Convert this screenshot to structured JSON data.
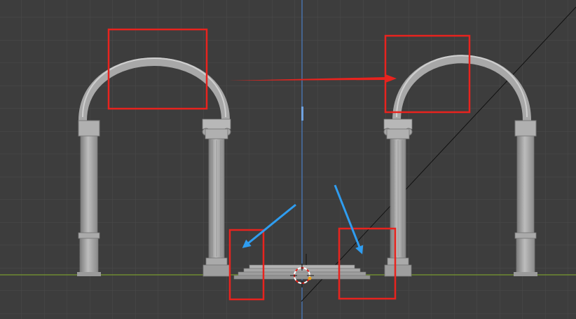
{
  "viewport": {
    "title": "",
    "colors": {
      "background": "#3d3d3d",
      "grid": "#4a4a4a",
      "x_axis": "#7a9a2f",
      "z_axis": "#4b7fc4",
      "model": "#9a9a9a",
      "model_light": "#b3b3b3",
      "model_dark": "#6e6e6e",
      "highlight_box": "#e8231e",
      "red_arrow": "#e8231e",
      "blue_arrow": "#2f9df0",
      "diagonal_line": "#111111"
    },
    "objects": [
      {
        "name": "left-arch",
        "kind": "arch"
      },
      {
        "name": "right-arch",
        "kind": "arch"
      },
      {
        "name": "center-base-steps",
        "kind": "base"
      },
      {
        "name": "3d-cursor",
        "kind": "cursor"
      }
    ],
    "annotations": {
      "boxes": [
        "arch-top-left",
        "arch-top-right",
        "base-left",
        "base-right"
      ],
      "red_arrow_icon": "arrow-right-icon",
      "blue_arrow_icons": [
        "arrow-down-left-icon",
        "arrow-down-right-icon"
      ]
    }
  }
}
